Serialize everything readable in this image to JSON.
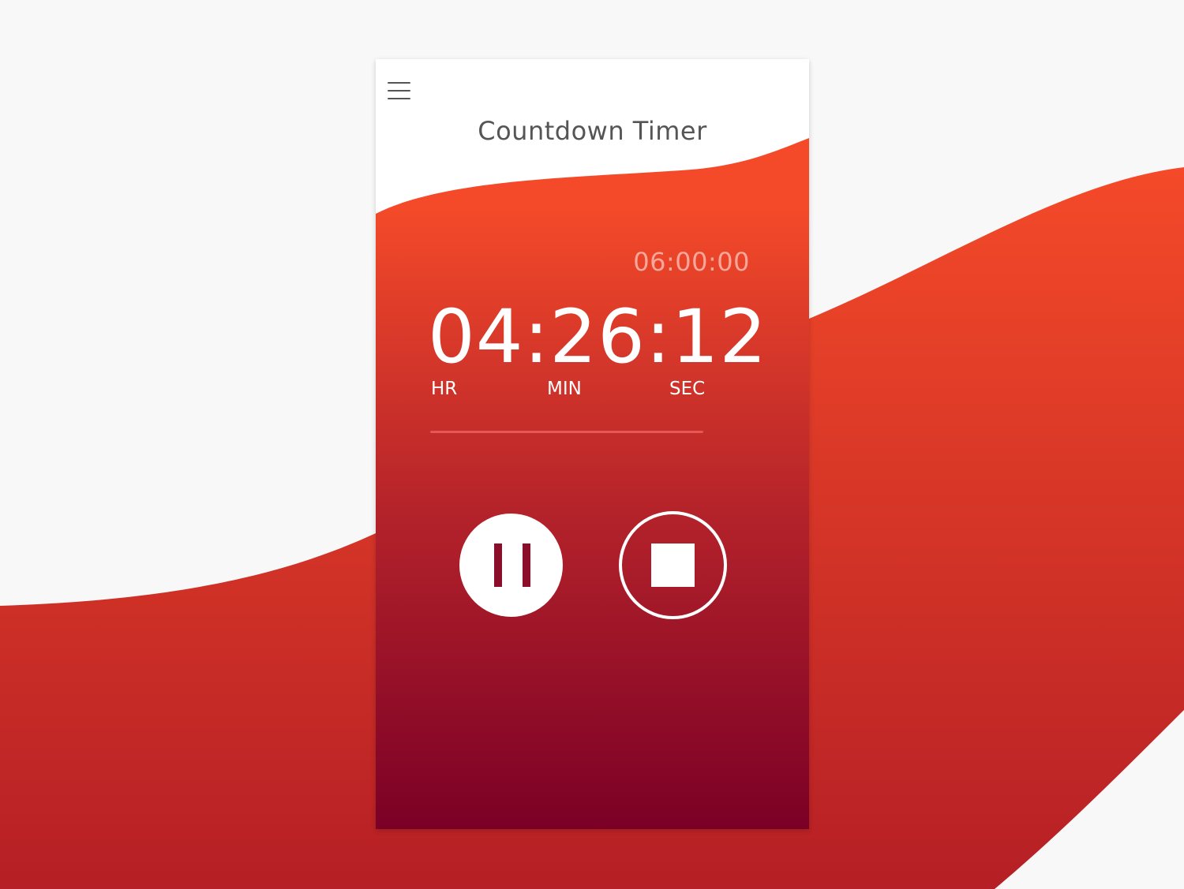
{
  "app": {
    "title": "Countdown Timer"
  },
  "timer": {
    "total": "06:00:00",
    "remaining": "04:26:12",
    "units": {
      "hr": "HR",
      "min": "MIN",
      "sec": "SEC"
    },
    "progress_fraction": 0.0
  },
  "controls": {
    "pause": "pause",
    "stop": "stop"
  },
  "icons": {
    "menu": "hamburger-menu-icon",
    "pause": "pause-icon",
    "stop": "stop-icon"
  },
  "colors": {
    "accent_top": "#f44a29",
    "accent_bottom": "#7c0127",
    "background": "#f8f8f8",
    "title_text": "#555555",
    "total_time_text": "#f7a79a"
  }
}
